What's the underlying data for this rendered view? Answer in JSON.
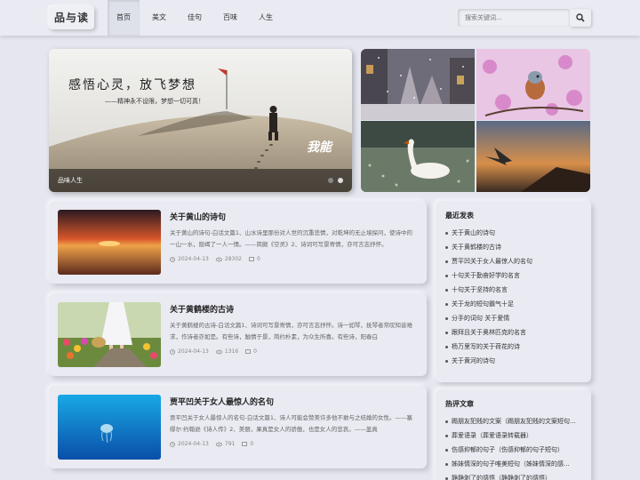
{
  "header": {
    "logo": "品与读",
    "menu": [
      {
        "label": "首页",
        "active": true
      },
      {
        "label": "美文"
      },
      {
        "label": "佳句"
      },
      {
        "label": "百味"
      },
      {
        "label": "人生"
      }
    ],
    "search_placeholder": "搜索关键词...",
    "search_icon": "search-icon"
  },
  "banner": {
    "headline": "感悟心灵，放飞梦想",
    "subline": "——精神永不设限，梦想一切可真！",
    "brand": "我能",
    "caption": "品味人生",
    "slide_count": 2,
    "active_slide": 2
  },
  "articles": [
    {
      "title": "关于黄山的诗句",
      "desc": "关于黄山的诗句-白话文篇1、山水诗里那份对人世的沉重悲情，对乾坤的无止境探问，使诗中的一山一水，隐竭了一人一情。——简颇《空灵》2、诗词可写景寄情，亦可言志抒怀。",
      "date": "2024-04-13",
      "views": "28302",
      "comments": "0"
    },
    {
      "title": "关于黄鹤楼的古诗",
      "desc": "关于黄鹤楼的古诗-白话文篇1、诗词可写景寄情，亦可言志抒怀。诗一如琴，抚琴者常叹知音难求，作诗者亦如是。有些诗，触情于景，简约朴素，为众生所喜。有些诗，阳春白",
      "date": "2024-04-13",
      "views": "1316",
      "comments": "0"
    },
    {
      "title": "贾平凹关于女人最惊人的名句",
      "desc": "贾平凹关于女人最惊人的名句-白话文篇1、诗人可能会赞美许多他不敢与之结婚的女性。——塞缪尔·约翰逊《诗人传》2、美丽，果真是女人的骄傲，也是女人的悲哀。——盖真",
      "date": "2024-04-13",
      "views": "791",
      "comments": "0"
    }
  ],
  "sidebar": {
    "recent": {
      "title": "最近发表",
      "items": [
        "关于黄山的诗句",
        "关于黄鹤楼的古诗",
        "贾平凹关于女人最惊人的名句",
        "十句关于勤奋好学的名言",
        "十句关于坚持的名言",
        "关于龙的短句霸气十足",
        "分手的词句 关于爱情",
        "跟拜且关于奥林匹克的名言",
        "杨万里写的关于荷花的诗",
        "关于黄河的诗句"
      ]
    },
    "hot": {
      "title": "热评文章",
      "items": [
        "踢朋友犯贱的文案（踢朋友犯贱的文案短句...",
        "葬爱语录（葬爱语录转载器）",
        "伤感抑郁的句子（伤感抑郁的句子短句）",
        "姊妹情深的句子唯美短句（姊妹情深的感...",
        "静静剥了的感悟（静静剥了的感悟）"
      ]
    }
  }
}
